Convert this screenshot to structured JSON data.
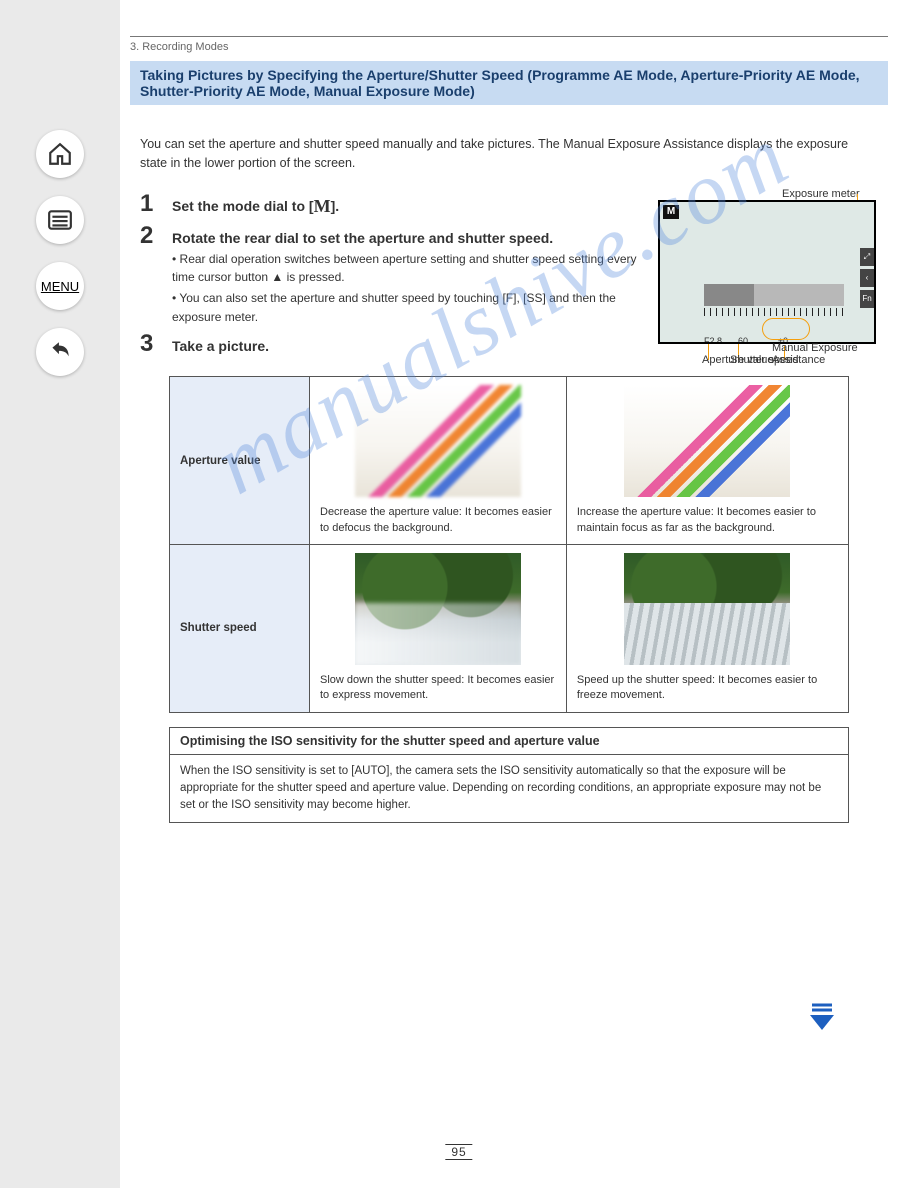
{
  "nav": {
    "home": "home-icon",
    "list": "list-icon",
    "menu_label": "MENU",
    "back": "back-icon"
  },
  "breadcrumb": "3. Recording Modes",
  "section_title": "Taking Pictures by Specifying the Aperture/Shutter Speed (Programme AE Mode, Aperture-Priority AE Mode, Shutter-Priority AE Mode, Manual Exposure Mode)",
  "intro": "You can set the aperture and shutter speed manually and take pictures. The Manual Exposure Assistance displays the exposure state in the lower portion of the screen.",
  "steps": {
    "s1": {
      "num": "1",
      "text_before": "Set the mode dial to [",
      "mode": "M",
      "text_after": "]."
    },
    "s2": {
      "num": "2",
      "text": "Rotate the rear dial to set the aperture and shutter speed.",
      "sub1": "Rear dial operation switches between aperture setting and shutter speed setting every time cursor button ▲ is pressed.",
      "sub2": "You can also set the aperture and shutter speed by touching [F], [SS] and then the exposure meter."
    },
    "s3": {
      "num": "3",
      "text": "Take a picture."
    }
  },
  "callouts": {
    "a": "Exposure meter",
    "b": "Aperture value",
    "c": "Shutter speed",
    "d": "Manual Exposure Assistance"
  },
  "screen": {
    "mode": "M",
    "right_icons": [
      "⤢",
      "‹",
      "Fn"
    ],
    "aperture_val": "F2.8",
    "shutter_val": "60",
    "assist": "±0"
  },
  "table": {
    "r1_label": "Aperture value",
    "r1c1": "Decrease the aperture value: It becomes easier to defocus the background.",
    "r1c2": "Increase the aperture value: It becomes easier to maintain focus as far as the background.",
    "r2_label": "Shutter speed",
    "r2c1": "Slow down the shutter speed: It becomes easier to express movement.",
    "r2c2": "Speed up the shutter speed: It becomes easier to freeze movement."
  },
  "optimize": {
    "head": "Optimising the ISO sensitivity for the shutter speed and aperture value",
    "body": "When the ISO sensitivity is set to [AUTO], the camera sets the ISO sensitivity automatically so that the exposure will be appropriate for the shutter speed and aperture value. Depending on recording conditions, an appropriate exposure may not be set or the ISO sensitivity may become higher."
  },
  "watermark": "manualshive.com",
  "page_number": "95"
}
